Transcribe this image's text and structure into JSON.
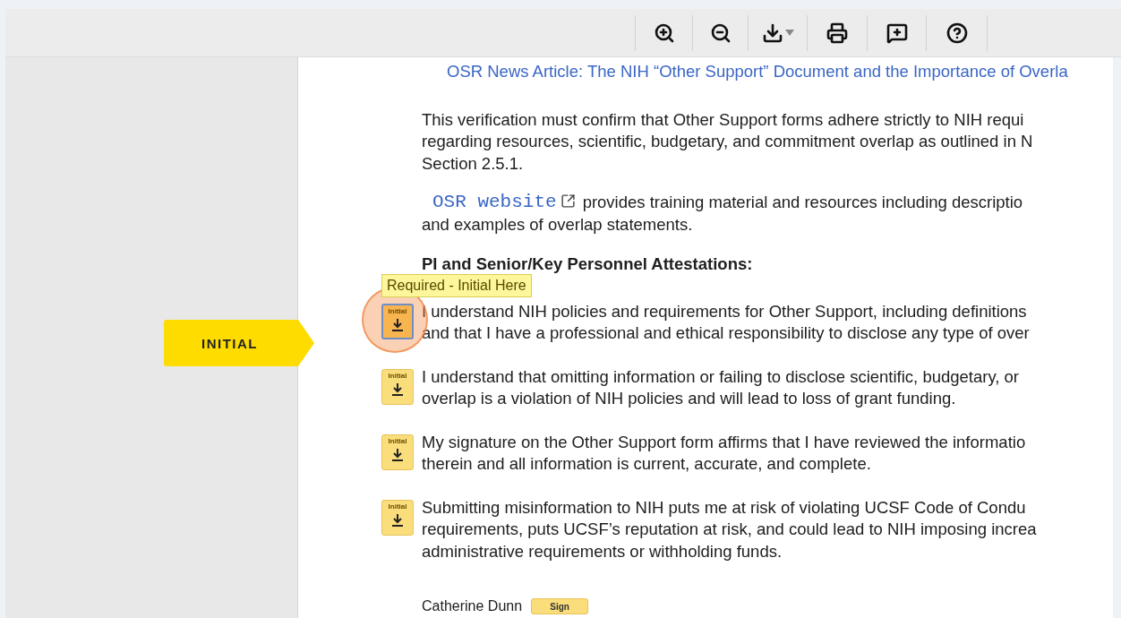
{
  "toolbar": {
    "buttons": [
      {
        "kind": "zoom-in"
      },
      {
        "kind": "zoom-out"
      },
      {
        "kind": "download"
      },
      {
        "kind": "print"
      },
      {
        "kind": "comment"
      },
      {
        "kind": "help"
      }
    ]
  },
  "guide_tag": {
    "label": "INITIAL"
  },
  "document": {
    "article_link": "OSR News Article: The NIH “Other Support” Document and the Importance of Overla",
    "verification_lines": [
      "This verification must confirm that Other Support forms adhere strictly to NIH requi",
      "regarding resources, scientific, budgetary, and commitment overlap as outlined in N",
      "Section 2.5.1."
    ],
    "website": {
      "link": "OSR website",
      "lines": [
        "provides training material and resources including descriptio",
        "and examples of overlap statements."
      ]
    },
    "heading": "PI and Senior/Key Personnel Attestations:",
    "tooltip": "Required - Initial Here",
    "attestations": [
      {
        "field_label": "Initial",
        "active": true,
        "lines": [
          "I understand NIH policies and requirements for Other Support, including definitions",
          "and that I have a professional and ethical responsibility to disclose any type of over"
        ]
      },
      {
        "field_label": "Initial",
        "active": false,
        "lines": [
          "I understand that omitting information or failing to disclose scientific, budgetary, or",
          "overlap is a violation of NIH policies and will lead to loss of grant funding."
        ]
      },
      {
        "field_label": "Initial",
        "active": false,
        "lines": [
          "My signature on the Other Support form affirms that I have reviewed the informatio",
          "therein and all information is current, accurate, and complete."
        ]
      },
      {
        "field_label": "Initial",
        "active": false,
        "lines": [
          "Submitting misinformation to NIH puts me at risk of violating UCSF Code of Condu",
          "requirements, puts UCSF’s reputation at risk, and could lead to NIH imposing increa",
          "administrative requirements or withholding funds."
        ]
      }
    ],
    "signer": {
      "name": "Catherine Dunn",
      "button": "Sign"
    }
  }
}
